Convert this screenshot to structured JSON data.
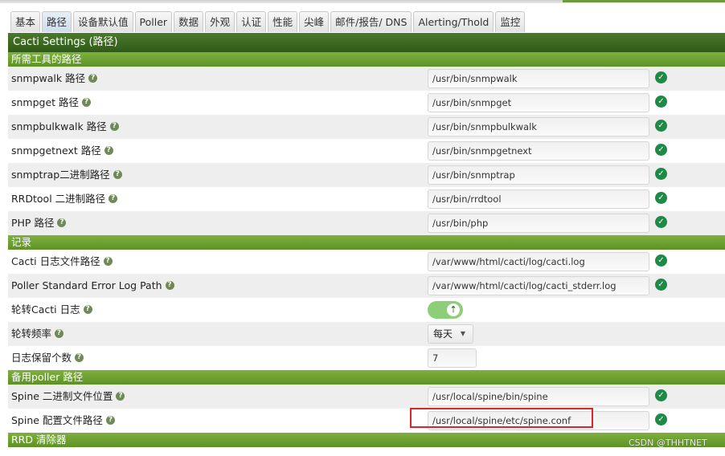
{
  "tabs": [
    {
      "label": "基本",
      "active": false
    },
    {
      "label": "路径",
      "active": true
    },
    {
      "label": "设备默认值",
      "active": false
    },
    {
      "label": "Poller",
      "active": false
    },
    {
      "label": "数据",
      "active": false
    },
    {
      "label": "外观",
      "active": false
    },
    {
      "label": "认证",
      "active": false
    },
    {
      "label": "性能",
      "active": false
    },
    {
      "label": "尖峰",
      "active": false
    },
    {
      "label": "邮件/报告/ DNS",
      "active": false
    },
    {
      "label": "Alerting/Thold",
      "active": false
    },
    {
      "label": "监控",
      "active": false
    }
  ],
  "title": "Cacti Settings (路径)",
  "sections": {
    "tools": {
      "title": "所需工具的路径",
      "rows": [
        {
          "label": "snmpwalk 路径",
          "value": "/usr/bin/snmpwalk"
        },
        {
          "label": "snmpget 路径",
          "value": "/usr/bin/snmpget"
        },
        {
          "label": "snmpbulkwalk 路径",
          "value": "/usr/bin/snmpbulkwalk"
        },
        {
          "label": "snmpgetnext 路径",
          "value": "/usr/bin/snmpgetnext"
        },
        {
          "label": "snmptrap二进制路径",
          "value": "/usr/bin/snmptrap"
        },
        {
          "label": "RRDtool 二进制路径",
          "value": "/usr/bin/rrdtool"
        },
        {
          "label": "PHP 路径",
          "value": "/usr/bin/php"
        }
      ]
    },
    "logging": {
      "title": "记录",
      "rows": [
        {
          "label": "Cacti 日志文件路径",
          "value": "/var/www/html/cacti/log/cacti.log"
        },
        {
          "label": "Poller Standard Error Log Path",
          "value": "/var/www/html/cacti/log/cacti_stderr.log"
        },
        {
          "label": "轮转Cacti 日志",
          "toggle_on": true
        },
        {
          "label": "轮转频率",
          "selected": "每天"
        },
        {
          "label": "日志保留个数",
          "value": "7"
        }
      ]
    },
    "spine": {
      "title": "备用poller 路径",
      "rows": [
        {
          "label": "Spine 二进制文件位置",
          "value": "/usr/local/spine/bin/spine"
        },
        {
          "label": "Spine 配置文件路径",
          "value": "/usr/local/spine/etc/spine.conf"
        }
      ]
    },
    "rrd": {
      "title": "RRD 清除器"
    }
  },
  "help_glyph": "?",
  "ok_glyph": "✓",
  "watermark": "CSDN @THHTNET",
  "colors": {
    "title_bar": "#2f5a18",
    "section_bar": "#6aa030",
    "highlight_box": "#d9252b",
    "ok": "#1f8a45"
  }
}
